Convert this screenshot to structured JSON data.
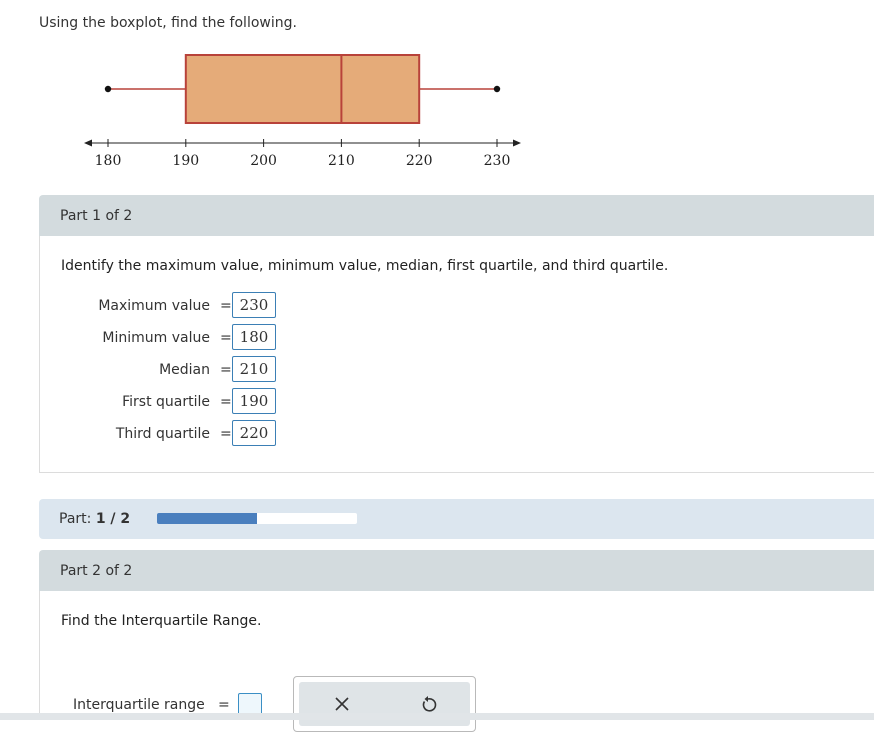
{
  "prompt": "Using the boxplot, find the following.",
  "chart_data": {
    "type": "boxplot",
    "min": 180,
    "q1": 190,
    "median": 210,
    "q3": 220,
    "max": 230,
    "ticks": [
      180,
      190,
      200,
      210,
      220,
      230
    ],
    "xlim": [
      180,
      230
    ],
    "box_fill": "#e5ab79",
    "box_stroke": "#b8423a"
  },
  "part1": {
    "header": "Part 1 of 2",
    "instruction": "Identify the maximum value, minimum value, median, first quartile, and third quartile.",
    "eq": "=",
    "answers": [
      {
        "label": "Maximum value",
        "value": "230"
      },
      {
        "label": "Minimum value",
        "value": "180"
      },
      {
        "label": "Median",
        "value": "210"
      },
      {
        "label": "First quartile",
        "value": "190"
      },
      {
        "label": "Third quartile",
        "value": "220"
      }
    ]
  },
  "progress": {
    "label": "Part:",
    "value": "1 / 2",
    "fraction": 0.5,
    "color": "#4a7fbe"
  },
  "part2": {
    "header": "Part 2 of 2",
    "instruction": "Find the Interquartile Range.",
    "input_label": "Interquartile range",
    "eq": "=",
    "tools": [
      "close-icon",
      "undo-icon"
    ]
  }
}
